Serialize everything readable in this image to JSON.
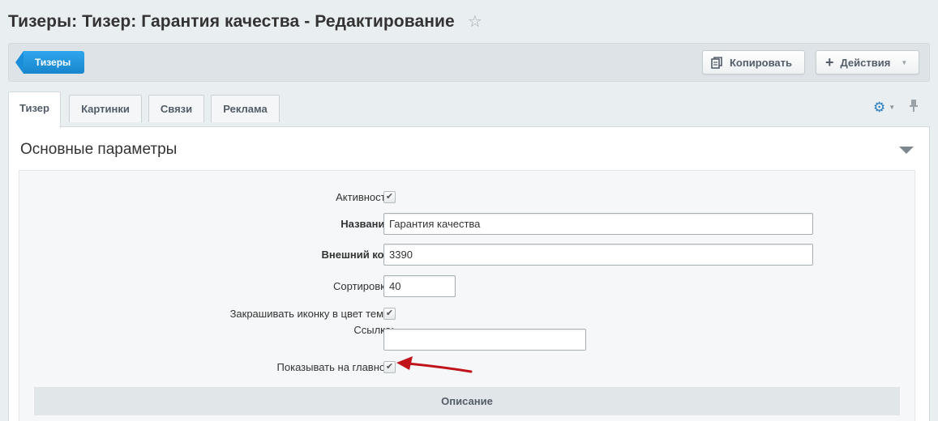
{
  "header": {
    "title": "Тизеры: Тизер: Гарантия качества - Редактирование",
    "star_icon": "star-icon"
  },
  "toolbar": {
    "back_label": "Тизеры",
    "copy_label": "Копировать",
    "actions_label": "Действия"
  },
  "tabs": [
    {
      "label": "Тизер",
      "active": true
    },
    {
      "label": "Картинки",
      "active": false
    },
    {
      "label": "Связи",
      "active": false
    },
    {
      "label": "Реклама",
      "active": false
    }
  ],
  "section": {
    "title": "Основные параметры"
  },
  "form": {
    "active": {
      "label": "Активность:",
      "checked": true
    },
    "name": {
      "label": "Название:",
      "value": "Гарантия качества"
    },
    "external_code": {
      "label": "Внешний код:",
      "value": "3390"
    },
    "sort": {
      "label": "Сортировка:",
      "value": "40"
    },
    "tint_icon": {
      "label": "Закрашивать иконку в цвет темы:",
      "checked": true
    },
    "link": {
      "label": "Ссылка:",
      "value": ""
    },
    "show_on_main": {
      "label": "Показывать на главной:",
      "checked": true
    }
  },
  "subsection": {
    "title": "Описание"
  },
  "colors": {
    "accent": "#1a8ed8",
    "arrow": "#c0141a"
  }
}
